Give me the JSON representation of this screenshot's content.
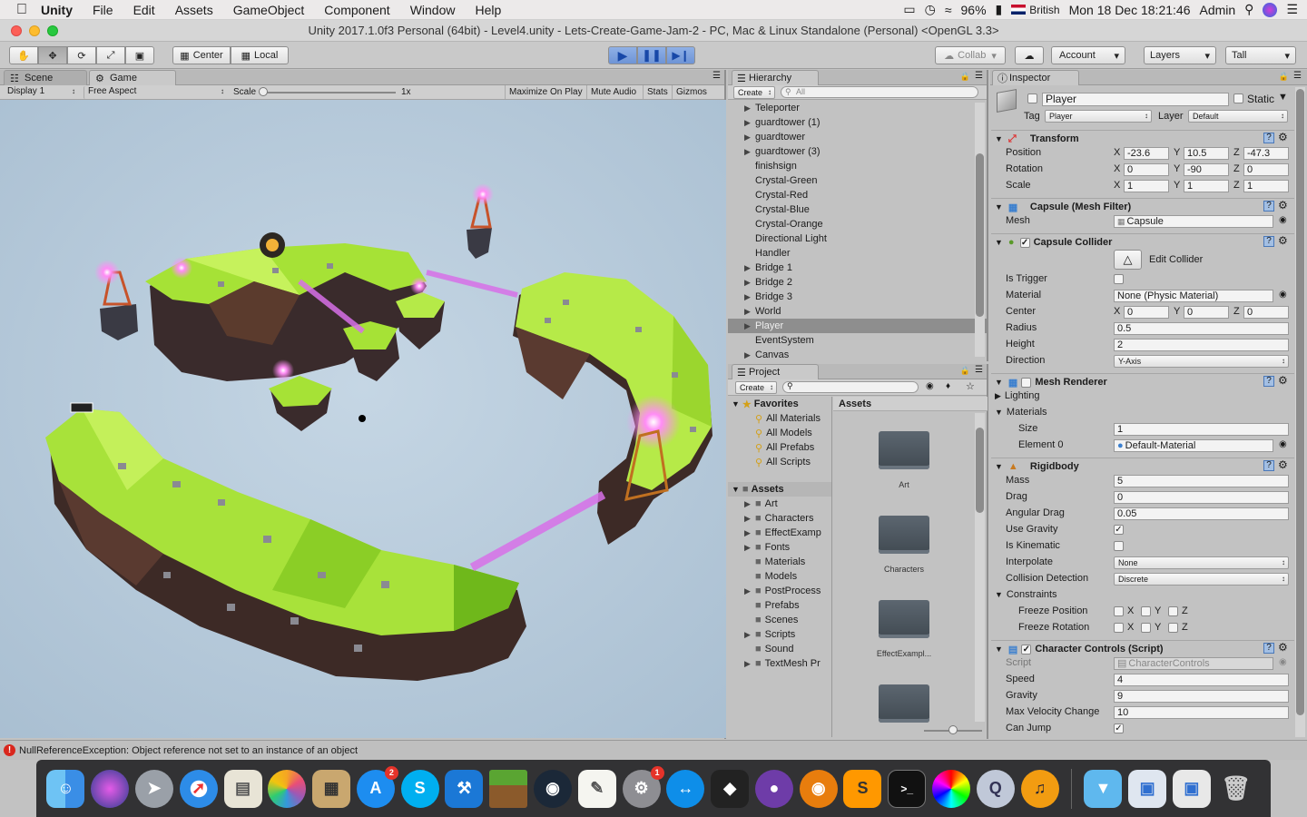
{
  "menubar": {
    "app": "Unity",
    "items": [
      "File",
      "Edit",
      "Assets",
      "GameObject",
      "Component",
      "Window",
      "Help"
    ],
    "battery": "96%",
    "keyboard": "British",
    "clock": "Mon 18 Dec  18:21:46",
    "user": "Admin"
  },
  "window": {
    "title": "Unity 2017.1.0f3 Personal (64bit) - Level4.unity - Lets-Create-Game-Jam-2 - PC, Mac & Linux Standalone (Personal) <OpenGL 3.3>"
  },
  "toolbar": {
    "center": "Center",
    "local": "Local",
    "collab": "Collab",
    "account": "Account",
    "layers": "Layers",
    "layout": "Tall"
  },
  "game": {
    "tab_scene": "Scene",
    "tab_game": "Game",
    "display": "Display 1",
    "aspect": "Free Aspect",
    "scale_label": "Scale",
    "scale_value": "1x",
    "maximize": "Maximize On Play",
    "mute": "Mute Audio",
    "stats": "Stats",
    "gizmos": "Gizmos"
  },
  "hierarchy": {
    "tab": "Hierarchy",
    "create": "Create",
    "search_placeholder": "All",
    "items": [
      {
        "name": "Teleporter",
        "arrow": true
      },
      {
        "name": "guardtower (1)",
        "arrow": true
      },
      {
        "name": "guardtower",
        "arrow": true
      },
      {
        "name": "guardtower (3)",
        "arrow": true
      },
      {
        "name": "finishsign",
        "arrow": false
      },
      {
        "name": "Crystal-Green",
        "arrow": false
      },
      {
        "name": "Crystal-Red",
        "arrow": false
      },
      {
        "name": "Crystal-Blue",
        "arrow": false
      },
      {
        "name": "Crystal-Orange",
        "arrow": false
      },
      {
        "name": "Directional Light",
        "arrow": false
      },
      {
        "name": "Handler",
        "arrow": false
      },
      {
        "name": "Bridge 1",
        "arrow": true
      },
      {
        "name": "Bridge 2",
        "arrow": true
      },
      {
        "name": "Bridge 3",
        "arrow": true
      },
      {
        "name": "World",
        "arrow": true
      },
      {
        "name": "Player",
        "arrow": true,
        "selected": true
      },
      {
        "name": "EventSystem",
        "arrow": false
      },
      {
        "name": "Canvas",
        "arrow": true
      }
    ]
  },
  "project": {
    "tab": "Project",
    "create": "Create",
    "favorites_label": "Favorites",
    "favorites": [
      "All Materials",
      "All Models",
      "All Prefabs",
      "All Scripts"
    ],
    "assets_label": "Assets",
    "folders": [
      {
        "name": "Art",
        "arrow": true
      },
      {
        "name": "Characters",
        "arrow": true
      },
      {
        "name": "EffectExamp",
        "arrow": true
      },
      {
        "name": "Fonts",
        "arrow": true
      },
      {
        "name": "Materials",
        "arrow": false
      },
      {
        "name": "Models",
        "arrow": false
      },
      {
        "name": "PostProcess",
        "arrow": true
      },
      {
        "name": "Prefabs",
        "arrow": false
      },
      {
        "name": "Scenes",
        "arrow": false
      },
      {
        "name": "Scripts",
        "arrow": true
      },
      {
        "name": "Sound",
        "arrow": false
      },
      {
        "name": "TextMesh Pr",
        "arrow": true
      }
    ],
    "grid_header": "Assets",
    "grid_items": [
      "Art",
      "Characters",
      "EffectExampl..."
    ]
  },
  "inspector": {
    "tab": "Inspector",
    "object_name": "Player",
    "static_label": "Static",
    "tag_label": "Tag",
    "tag_value": "Player",
    "layer_label": "Layer",
    "layer_value": "Default",
    "transform": {
      "title": "Transform",
      "position_label": "Position",
      "rotation_label": "Rotation",
      "scale_label": "Scale",
      "position": [
        "-23.6",
        "10.5",
        "-47.3"
      ],
      "rotation": [
        "0",
        "-90",
        "0"
      ],
      "scale": [
        "1",
        "1",
        "1"
      ]
    },
    "mesh_filter": {
      "title": "Capsule (Mesh Filter)",
      "mesh_label": "Mesh",
      "mesh_value": "Capsule"
    },
    "capsule_collider": {
      "title": "Capsule Collider",
      "edit_collider": "Edit Collider",
      "is_trigger_label": "Is Trigger",
      "material_label": "Material",
      "material_value": "None (Physic Material)",
      "center_label": "Center",
      "center": [
        "0",
        "0",
        "0"
      ],
      "radius_label": "Radius",
      "radius": "0.5",
      "height_label": "Height",
      "height": "2",
      "direction_label": "Direction",
      "direction": "Y-Axis"
    },
    "mesh_renderer": {
      "title": "Mesh Renderer",
      "lighting": "Lighting",
      "materials": "Materials",
      "size_label": "Size",
      "size": "1",
      "element_label": "Element 0",
      "element_value": "Default-Material"
    },
    "rigidbody": {
      "title": "Rigidbody",
      "mass_label": "Mass",
      "mass": "5",
      "drag_label": "Drag",
      "drag": "0",
      "angular_drag_label": "Angular Drag",
      "angular_drag": "0.05",
      "use_gravity_label": "Use Gravity",
      "is_kinematic_label": "Is Kinematic",
      "interpolate_label": "Interpolate",
      "interpolate": "None",
      "collision_label": "Collision Detection",
      "collision": "Discrete",
      "constraints_label": "Constraints",
      "freeze_pos_label": "Freeze Position",
      "freeze_rot_label": "Freeze Rotation"
    },
    "character_controls": {
      "title": "Character Controls (Script)",
      "script_label": "Script",
      "script_value": "CharacterControls",
      "speed_label": "Speed",
      "speed": "4",
      "gravity_label": "Gravity",
      "gravity": "9",
      "max_velocity_label": "Max Velocity Change",
      "max_velocity": "10",
      "can_jump_label": "Can Jump"
    }
  },
  "status": {
    "error": "NullReferenceException: Object reference not set to an instance of an object"
  },
  "axis": {
    "x": "X",
    "y": "Y",
    "z": "Z"
  },
  "dock": {
    "badges": {
      "appstore": "2",
      "prefs": "1"
    }
  }
}
